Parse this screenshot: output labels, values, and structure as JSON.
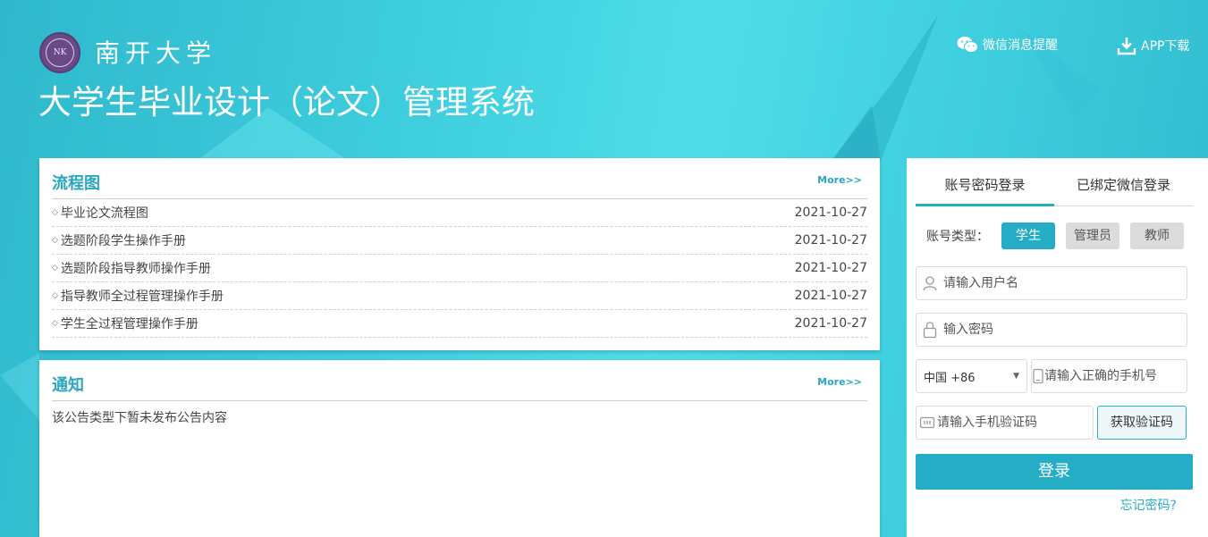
{
  "header": {
    "university": "南开大学",
    "system_title": "大学生毕业设计（论文）管理系统",
    "logo_text": "NK",
    "wechat_label": "微信消息提醒",
    "app_label": "APP下载"
  },
  "flow": {
    "title": "流程图",
    "more": "More>>",
    "items": [
      {
        "title": "毕业论文流程图",
        "date": "2021-10-27"
      },
      {
        "title": "选题阶段学生操作手册",
        "date": "2021-10-27"
      },
      {
        "title": "选题阶段指导教师操作手册",
        "date": "2021-10-27"
      },
      {
        "title": "指导教师全过程管理操作手册",
        "date": "2021-10-27"
      },
      {
        "title": "学生全过程管理操作手册",
        "date": "2021-10-27"
      }
    ]
  },
  "notice": {
    "title": "通知",
    "more": "More>>",
    "empty_text": "该公告类型下暂未发布公告内容"
  },
  "login": {
    "tabs": [
      "账号密码登录",
      "已绑定微信登录"
    ],
    "active_tab": 0,
    "type_label": "账号类型：",
    "types": [
      "学生",
      "管理员",
      "教师"
    ],
    "active_type": 0,
    "username_placeholder": "请输入用户名",
    "password_placeholder": "输入密码",
    "country_code": "中国 +86",
    "phone_placeholder": "请输入正确的手机号",
    "sms_placeholder": "请输入手机验证码",
    "get_code": "获取验证码",
    "submit": "登录",
    "forgot": "忘记密码?"
  },
  "colors": {
    "accent": "#25adc6",
    "title_teal": "#2aa6c0",
    "bg_cyan": "#3fcfdf"
  }
}
